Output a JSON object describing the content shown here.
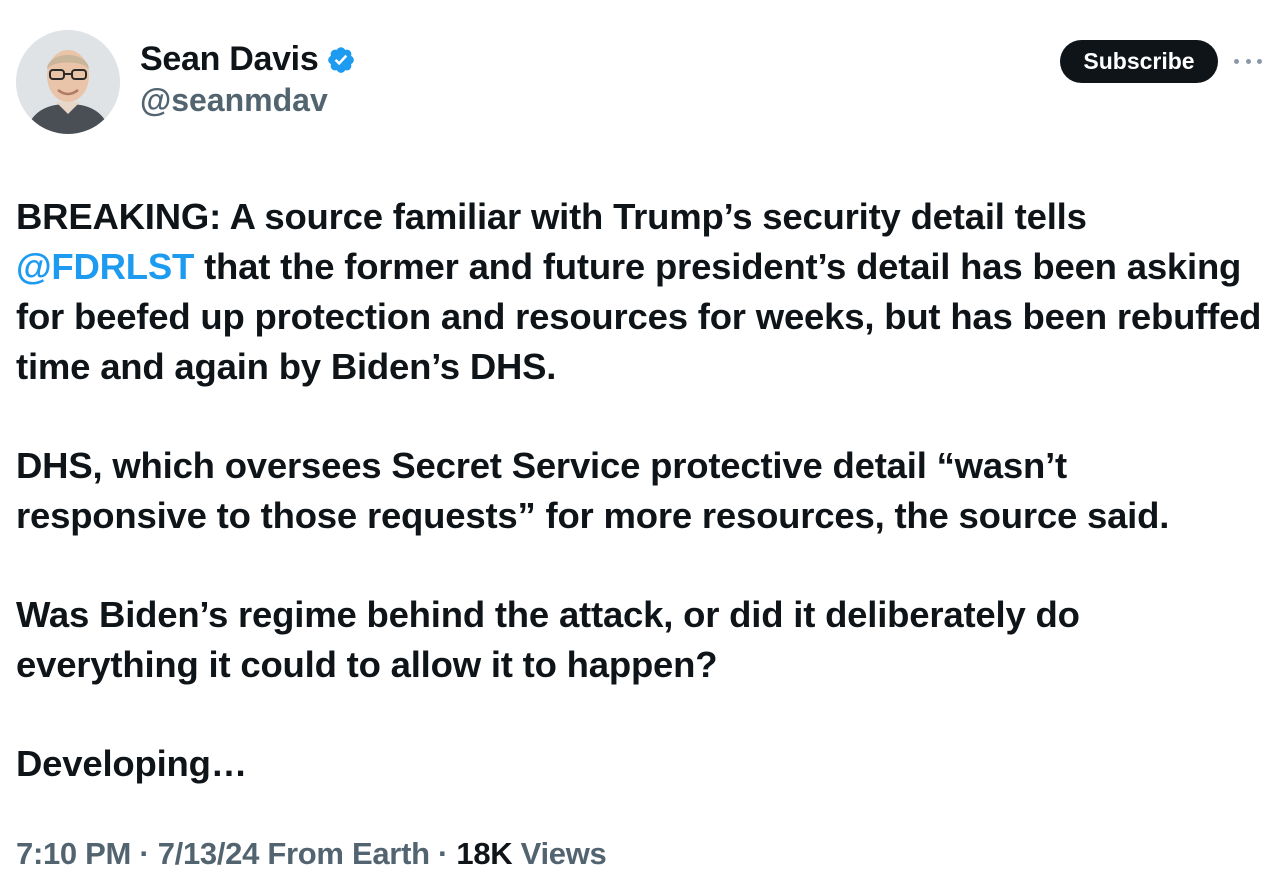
{
  "author": {
    "display_name": "Sean Davis",
    "handle": "@seanmdav",
    "verified": true,
    "verified_color": "#1d9bf0"
  },
  "header": {
    "subscribe_label": "Subscribe",
    "more_icon": "ellipsis-icon"
  },
  "tweet": {
    "p1_pre": "BREAKING: A source familiar with Trump’s security detail tells ",
    "p1_mention": "@FDRLST",
    "p1_post": " that the former and future president’s detail has been asking for beefed up protection and resources for weeks, but has been rebuffed time and again by Biden’s DHS.",
    "p2": "DHS, which oversees Secret Service protective detail “wasn’t responsive to those requests” for more resources, the source said.",
    "p3": "Was Biden’s regime behind the attack, or did it deliberately do everything it could to allow it to happen?",
    "p4": "Developing…"
  },
  "meta": {
    "time": "7:10 PM",
    "sep1": " · ",
    "date": "7/13/24",
    "source": " From Earth",
    "sep2": " · ",
    "views_count": "18K",
    "views_label": " Views"
  },
  "colors": {
    "text": "#0f1419",
    "secondary": "#536471",
    "link": "#1d9bf0",
    "button_bg": "#0f1419"
  }
}
